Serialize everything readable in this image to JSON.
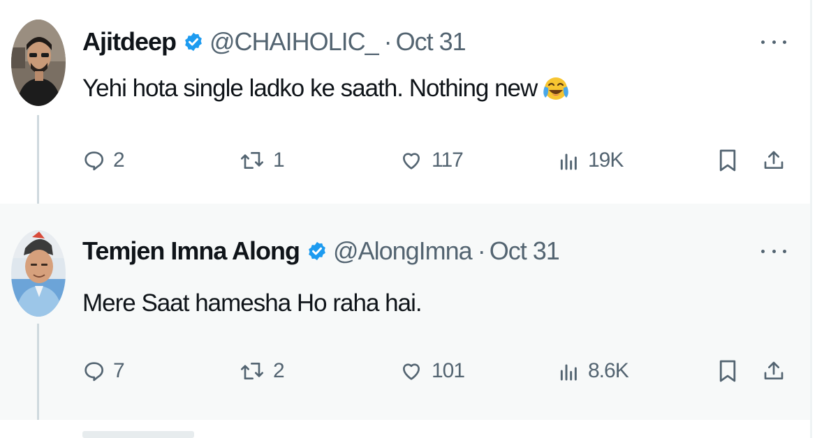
{
  "tweets": [
    {
      "display_name": "Ajitdeep",
      "handle": "@CHAIHOLIC_",
      "separator": "·",
      "date": "Oct 31",
      "text": "Yehi hota single ladko ke saath. Nothing new",
      "emoji": "face-with-tears-of-joy",
      "replies": "2",
      "reposts": "1",
      "likes": "117",
      "views": "19K"
    },
    {
      "display_name": "Temjen Imna Along",
      "handle": "@AlongImna",
      "separator": "·",
      "date": "Oct 31",
      "text": "Mere Saat hamesha Ho raha hai.",
      "replies": "7",
      "reposts": "2",
      "likes": "101",
      "views": "8.6K"
    }
  ],
  "icons": {
    "verified": "verified-badge-icon",
    "more": "more-options-icon",
    "reply": "reply-icon",
    "repost": "repost-icon",
    "like": "heart-icon",
    "views": "views-chart-icon",
    "bookmark": "bookmark-icon",
    "share": "share-icon"
  },
  "colors": {
    "verified": "#1d9bf0",
    "text_primary": "#0f1419",
    "text_secondary": "#536471",
    "thread_line": "#cfd9de",
    "highlight_bg": "#f7f9f9"
  }
}
